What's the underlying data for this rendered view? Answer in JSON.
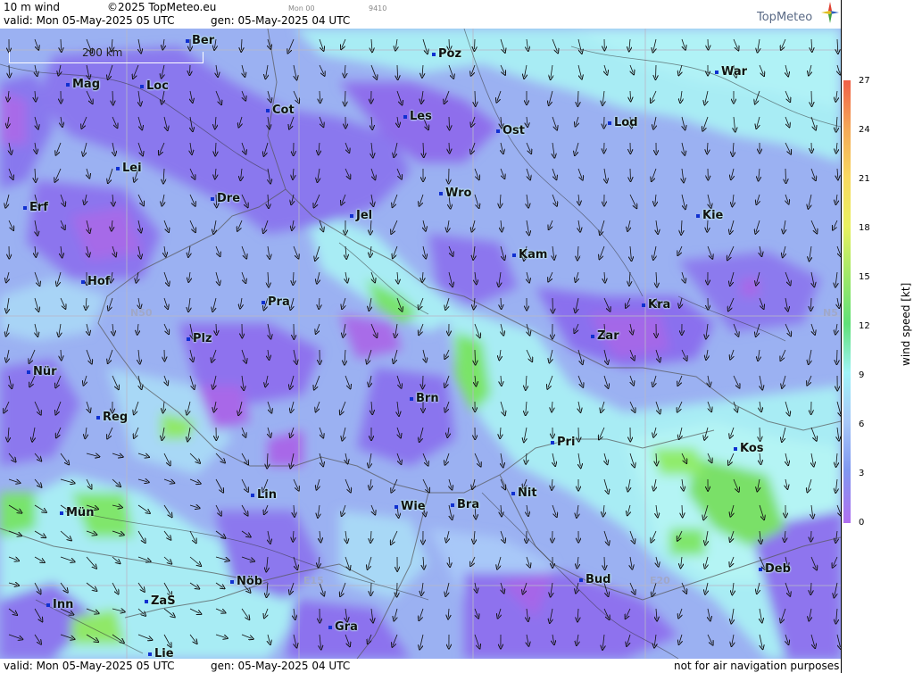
{
  "header": {
    "product": "10 m wind",
    "copyright": "©2025 TopMeteo.eu",
    "run_code": "Mon 00",
    "run_id": "9410",
    "valid": "valid:  Mon  05-May-2025  05 UTC",
    "generated": "gen: 05-May-2025 04 UTC",
    "brand": "TopMeteo"
  },
  "footer": {
    "valid": "valid:  Mon  05-May-2025  05 UTC",
    "generated": "gen: 05-May-2025 04 UTC",
    "disclaimer": "not for air navigation purposes"
  },
  "scale": {
    "label": "200 km"
  },
  "grid_labels": [
    "N50",
    "N5",
    "E15",
    "E20"
  ],
  "legend": {
    "title": "wind speed [kt]",
    "ticks": [
      "27",
      "24",
      "21",
      "18",
      "15",
      "12",
      "9",
      "6",
      "3",
      "0"
    ],
    "colors": [
      "#f06048",
      "#f4a858",
      "#f8d860",
      "#e8f060",
      "#a0e868",
      "#60e078",
      "#a0f4f8",
      "#a8c8f8",
      "#8098f0",
      "#a070f0"
    ]
  },
  "cities": [
    {
      "name": "Ber"
    },
    {
      "name": "Poz"
    },
    {
      "name": "War"
    },
    {
      "name": "Mag"
    },
    {
      "name": "Loc"
    },
    {
      "name": "Cot"
    },
    {
      "name": "Les"
    },
    {
      "name": "Ost"
    },
    {
      "name": "Lod"
    },
    {
      "name": "Lei"
    },
    {
      "name": "Erf"
    },
    {
      "name": "Dre"
    },
    {
      "name": "Jel"
    },
    {
      "name": "Wro"
    },
    {
      "name": "Kie"
    },
    {
      "name": "Kam"
    },
    {
      "name": "Hof"
    },
    {
      "name": "Pra"
    },
    {
      "name": "Kra"
    },
    {
      "name": "Plz"
    },
    {
      "name": "Zar"
    },
    {
      "name": "Nür"
    },
    {
      "name": "Brn"
    },
    {
      "name": "Reg"
    },
    {
      "name": "Pri"
    },
    {
      "name": "Kos"
    },
    {
      "name": "Lin"
    },
    {
      "name": "Nit"
    },
    {
      "name": "Mün"
    },
    {
      "name": "Wie"
    },
    {
      "name": "Bra"
    },
    {
      "name": "Deb"
    },
    {
      "name": "Nöb"
    },
    {
      "name": "Bud"
    },
    {
      "name": "Inn"
    },
    {
      "name": "ZaS"
    },
    {
      "name": "Gra"
    },
    {
      "name": "Lie"
    }
  ]
}
